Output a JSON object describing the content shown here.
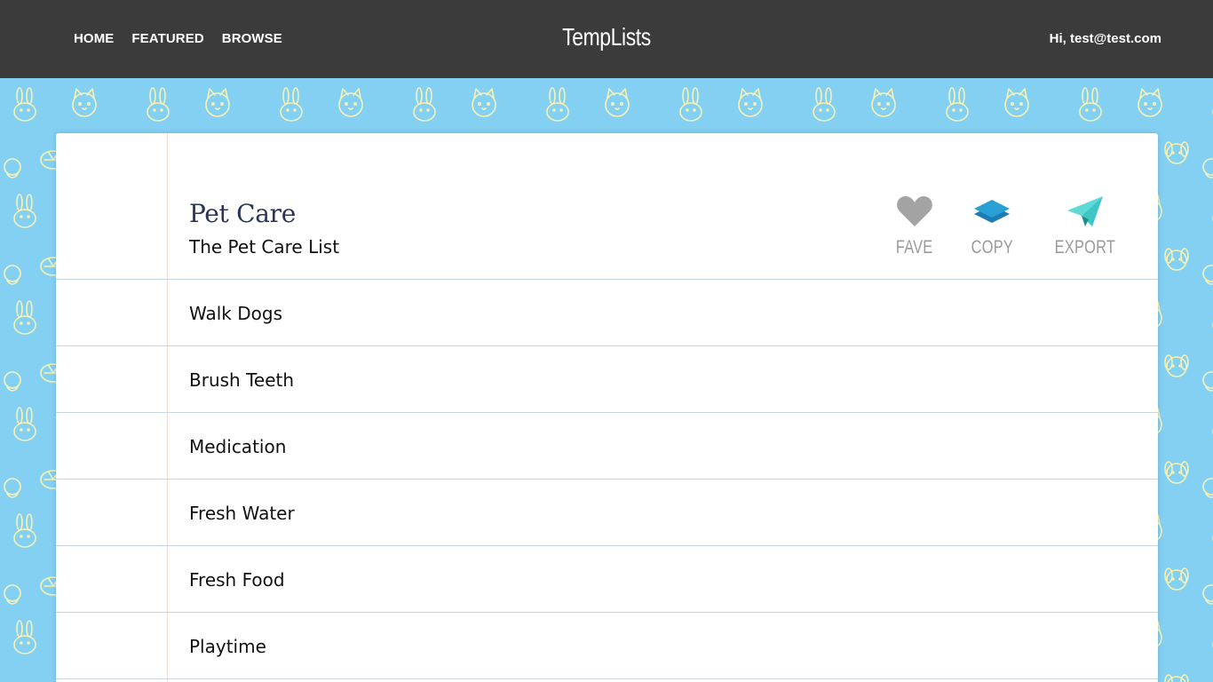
{
  "nav": {
    "links": [
      {
        "label": "HOME"
      },
      {
        "label": "FEATURED"
      },
      {
        "label": "BROWSE"
      }
    ],
    "brand": "TempLists",
    "greeting": "Hi, test@test.com"
  },
  "list": {
    "title": "Pet Care",
    "subtitle": "The Pet Care List",
    "actions": {
      "fave": {
        "label": "FAVE",
        "icon": "heart-icon",
        "color": "#a3a3a3"
      },
      "copy": {
        "label": "COPY",
        "icon": "layers-icon",
        "color": "#2a8bbf"
      },
      "export": {
        "label": "EXPORT",
        "icon": "paper-plane-icon",
        "color": "#3cc6c6"
      }
    },
    "items": [
      {
        "text": "Walk Dogs"
      },
      {
        "text": "Brush Teeth"
      },
      {
        "text": "Medication"
      },
      {
        "text": "Fresh Water"
      },
      {
        "text": "Fresh Food"
      },
      {
        "text": "Playtime"
      }
    ]
  },
  "theme": {
    "navbar_bg": "#3b3b3b",
    "page_bg": "#84d0f3",
    "pattern_color": "#f6f1b5",
    "title_color": "#2a3358"
  }
}
